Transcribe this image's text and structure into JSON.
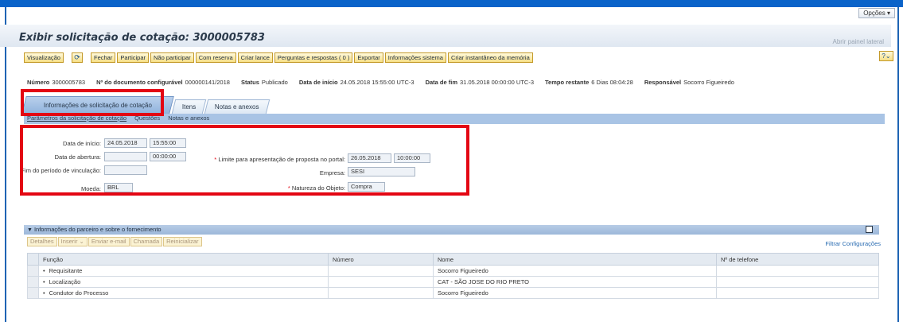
{
  "options_label": "Opções ▾",
  "page_title": "Exibir solicitação de cotação: 3000005783",
  "side_panel_link": "Abrir painel lateral",
  "toolbar": {
    "visualizacao": "Visualização",
    "fechar": "Fechar",
    "participar": "Participar",
    "nao_participar": "Não participar",
    "com_reserva": "Com reserva",
    "criar_lance": "Criar lance",
    "perguntas": "Perguntas e respostas ( 0 )",
    "exportar": "Exportar",
    "info_sistema": "Informações sistema",
    "instantaneo": "Criar instantâneo da memória"
  },
  "header": {
    "numero_label": "Número",
    "numero": "3000005783",
    "doc_label": "Nº do documento configurável",
    "doc": "000000141/2018",
    "status_label": "Status",
    "status": "Publicado",
    "inicio_label": "Data de início",
    "inicio": "24.05.2018 15:55:00 UTC-3",
    "fim_label": "Data de fim",
    "fim": "31.05.2018 00:00:00 UTC-3",
    "restante_label": "Tempo restante",
    "restante": "6 Dias 08:04:28",
    "responsavel_label": "Responsável",
    "responsavel": "Socorro Figueiredo"
  },
  "tabs": {
    "info": "Informações de solicitação de cotação",
    "itens": "Itens",
    "notas": "Notas e anexos"
  },
  "subtabs": {
    "parametros": "Parâmetros da solicitação de cotação",
    "questoes": "Questões",
    "notas": "Notas e anexos"
  },
  "form": {
    "data_inicio_label": "Data de início:",
    "data_inicio": "24.05.2018",
    "hora_inicio": "15:55:00",
    "data_abertura_label": "Data de abertura:",
    "data_abertura": "",
    "hora_abertura": "00:00:00",
    "fim_periodo_label": "Fim do período de vinculação:",
    "fim_periodo": "",
    "moeda_label": "Moeda:",
    "moeda": "BRL",
    "limite_label": "Limite para apresentação de proposta no portal:",
    "limite_data": "26.05.2018",
    "limite_hora": "10:00:00",
    "empresa_label": "Empresa:",
    "empresa": "SESI",
    "natureza_label": "Natureza do Objeto:",
    "natureza": "Compra"
  },
  "partners": {
    "section_title": "Informações do parceiro e sobre o fornecimento",
    "buttons": {
      "detalhes": "Detalhes",
      "inserir": "Inserir ⌄",
      "email": "Enviar e-mail",
      "chamada": "Chamada",
      "reinicializar": "Reinicializar"
    },
    "filter_link": "Filtrar Configurações",
    "columns": {
      "funcao": "Função",
      "numero": "Número",
      "nome": "Nome",
      "telefone": "Nº de telefone"
    },
    "rows": [
      {
        "funcao": "Requisitante",
        "numero": "",
        "nome": "Socorro Figueiredo",
        "telefone": ""
      },
      {
        "funcao": "Localização",
        "numero": "",
        "nome": "CAT - SÃO JOSE DO RIO PRETO",
        "telefone": ""
      },
      {
        "funcao": "Condutor do Processo",
        "numero": "",
        "nome": "Socorro Figueiredo",
        "telefone": ""
      }
    ]
  }
}
